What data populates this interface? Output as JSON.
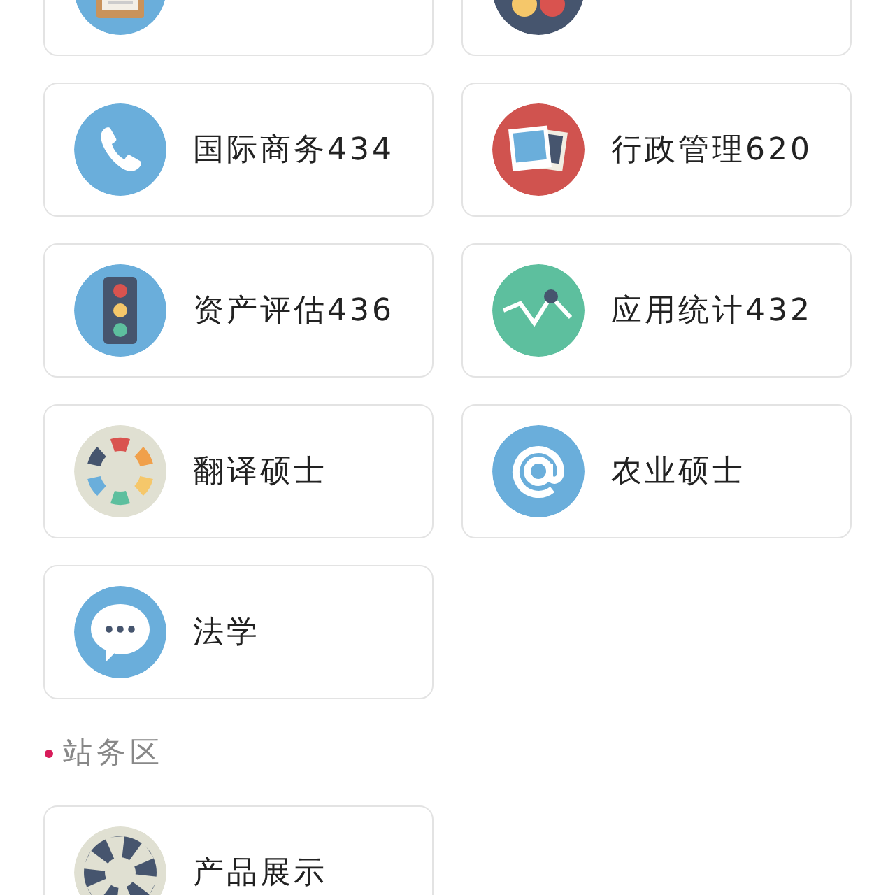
{
  "groups": [
    {
      "cards": [
        {
          "kind": "clipboard"
        },
        {
          "kind": "dots"
        },
        {
          "kind": "phone",
          "label": "国际商务434"
        },
        {
          "kind": "photos",
          "label": "行政管理620"
        },
        {
          "kind": "traffic-light",
          "label": "资产评估436"
        },
        {
          "kind": "line-chart",
          "label": "应用统计432"
        },
        {
          "kind": "ring",
          "label": "翻译硕士"
        },
        {
          "kind": "at",
          "label": "农业硕士"
        },
        {
          "kind": "chat",
          "label": "法学"
        }
      ]
    },
    {
      "title": "站务区",
      "cards": [
        {
          "kind": "aperture",
          "label": "产品展示"
        }
      ]
    }
  ]
}
